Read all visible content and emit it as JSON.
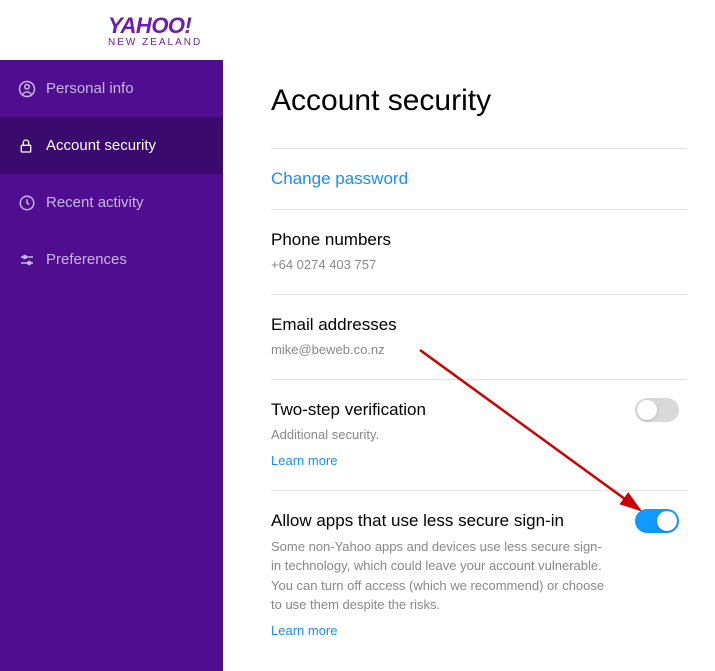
{
  "brand": {
    "name": "YAHOO",
    "region": "NEW ZEALAND"
  },
  "sidebar": {
    "items": [
      {
        "label": "Personal info"
      },
      {
        "label": "Account security"
      },
      {
        "label": "Recent activity"
      },
      {
        "label": "Preferences"
      }
    ]
  },
  "page": {
    "title": "Account security"
  },
  "change_password": {
    "label": "Change password"
  },
  "phone": {
    "heading": "Phone numbers",
    "value": "+64 0274 403 757"
  },
  "email": {
    "heading": "Email addresses",
    "value": "mike@beweb.co.nz"
  },
  "twostep": {
    "heading": "Two-step verification",
    "sub": "Additional security.",
    "learn": "Learn more",
    "enabled": false
  },
  "lesssecure": {
    "heading": "Allow apps that use less secure sign-in",
    "desc": "Some non-Yahoo apps and devices use less secure sign-in technology, which could leave your account vulnerable. You can turn off access (which we recommend) or choose to use them despite the risks.",
    "learn": "Learn more",
    "enabled": true
  }
}
